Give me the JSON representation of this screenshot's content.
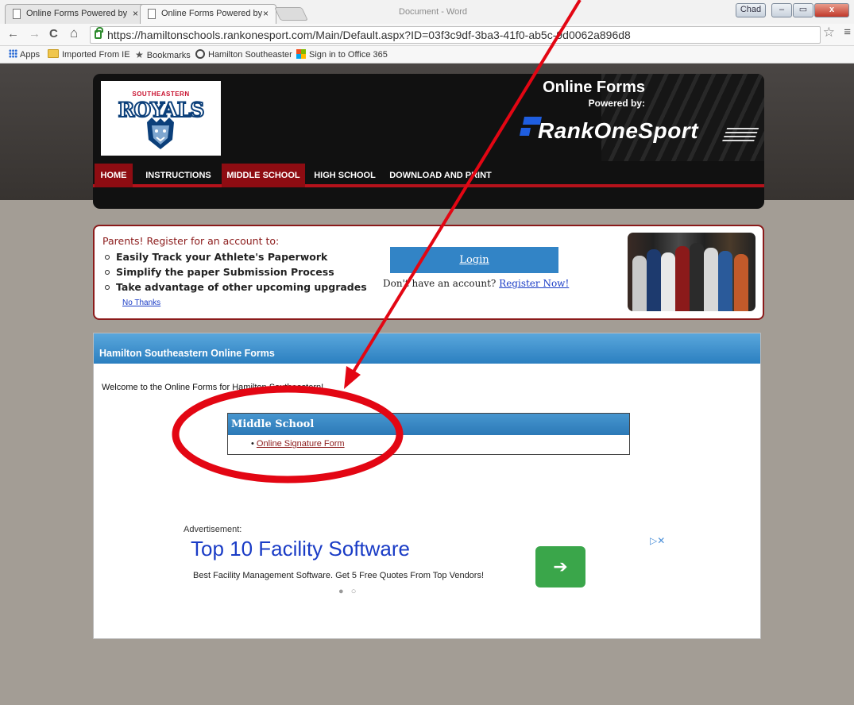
{
  "browser": {
    "tabs": [
      {
        "label": "Online Forms Powered by",
        "close": "×"
      },
      {
        "label": "Online Forms Powered by",
        "close": "×"
      }
    ],
    "window_title": "Document - Word",
    "user_button": "Chad",
    "min_glyph": "–",
    "max_glyph": "▭",
    "close_glyph": "x",
    "nav": {
      "back": "←",
      "forward": "→",
      "reload": "C",
      "home": "⌂"
    },
    "url": "https://hamiltonschools.rankonesport.com/Main/Default.aspx?ID=03f3c9df-3ba3-41f0-ab5c-9d0062a896d8",
    "star": "☆",
    "menu": "≡",
    "bookmarks": {
      "apps": "Apps",
      "imported": "Imported From IE",
      "bookmarks": "Bookmarks",
      "hamilton": "Hamilton Southeaster",
      "office": "Sign in to Office 365"
    }
  },
  "header": {
    "logo_top": "SOUTHEASTERN",
    "logo_word": "ROYALS",
    "online_forms": "Online Forms",
    "powered_by": "Powered by:",
    "brand": "RankOneSport",
    "nav": [
      "HOME",
      "INSTRUCTIONS",
      "MIDDLE SCHOOL",
      "HIGH SCHOOL",
      "DOWNLOAD AND PRINT"
    ]
  },
  "banner": {
    "heading": "Parents! Register for an account to:",
    "items": [
      "Easily Track your Athlete's Paperwork",
      "Simplify the paper Submission Process",
      "Take advantage of other upcoming upgrades"
    ],
    "no_thanks": "No Thanks",
    "login": "Login",
    "no_account": "Don't have an account?",
    "register": "Register Now!"
  },
  "forms": {
    "title": "Hamilton Southeastern Online Forms",
    "welcome": "Welcome to the Online Forms for Hamilton Southeastern!",
    "section": "Middle School",
    "link": "Online Signature Form"
  },
  "ad": {
    "label": "Advertisement:",
    "title": "Top 10 Facility Software",
    "desc": "Best Facility Management Software. Get 5 Free Quotes From Top Vendors!",
    "go": "➔",
    "choices": "▷✕",
    "dots": "● ○"
  },
  "colors": {
    "accent_red": "#b5121b",
    "brand_blue": "#3284c6",
    "annotation_red": "#e30613"
  }
}
